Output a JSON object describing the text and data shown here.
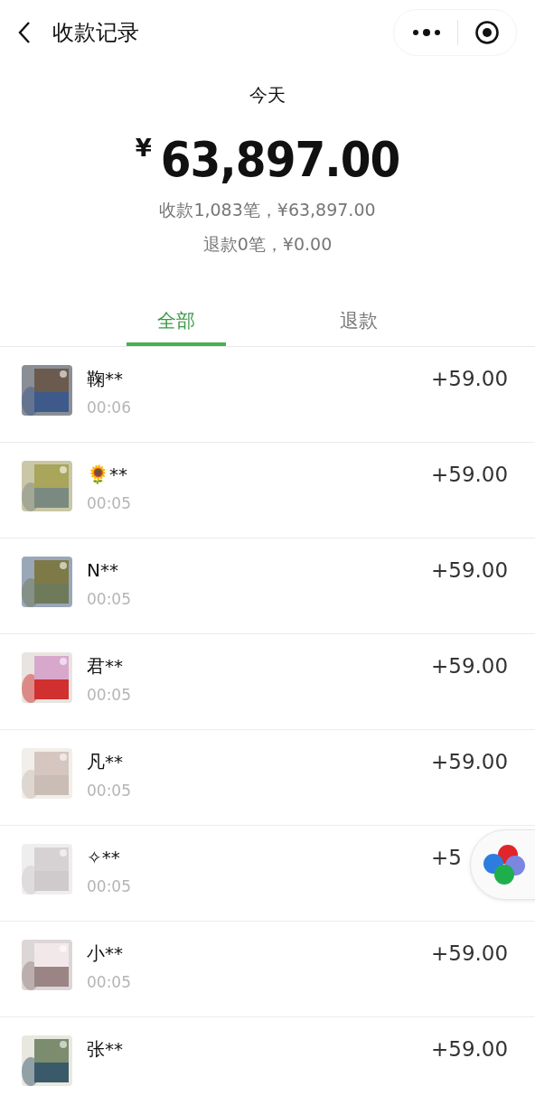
{
  "nav": {
    "title": "收款记录"
  },
  "summary": {
    "period": "今天",
    "currency": "¥",
    "total": "63,897.00",
    "received": "收款1,083笔，¥63,897.00",
    "refunded": "退款0笔，¥0.00"
  },
  "tabs": [
    {
      "label": "全部",
      "selected": true
    },
    {
      "label": "退款",
      "selected": false
    }
  ],
  "records": [
    {
      "name": "鞠**",
      "time": "00:06",
      "amount": "+59.00"
    },
    {
      "name": "🌻**",
      "time": "00:05",
      "amount": "+59.00"
    },
    {
      "name": "N**",
      "time": "00:05",
      "amount": "+59.00"
    },
    {
      "name": "君**",
      "time": "00:05",
      "amount": "+59.00"
    },
    {
      "name": "凡**",
      "time": "00:05",
      "amount": "+59.00"
    },
    {
      "name": "✧**",
      "time": "00:05",
      "amount": "+5"
    },
    {
      "name": "小**",
      "time": "00:05",
      "amount": "+59.00"
    },
    {
      "name": "张**",
      "amount": "+59.00"
    }
  ]
}
